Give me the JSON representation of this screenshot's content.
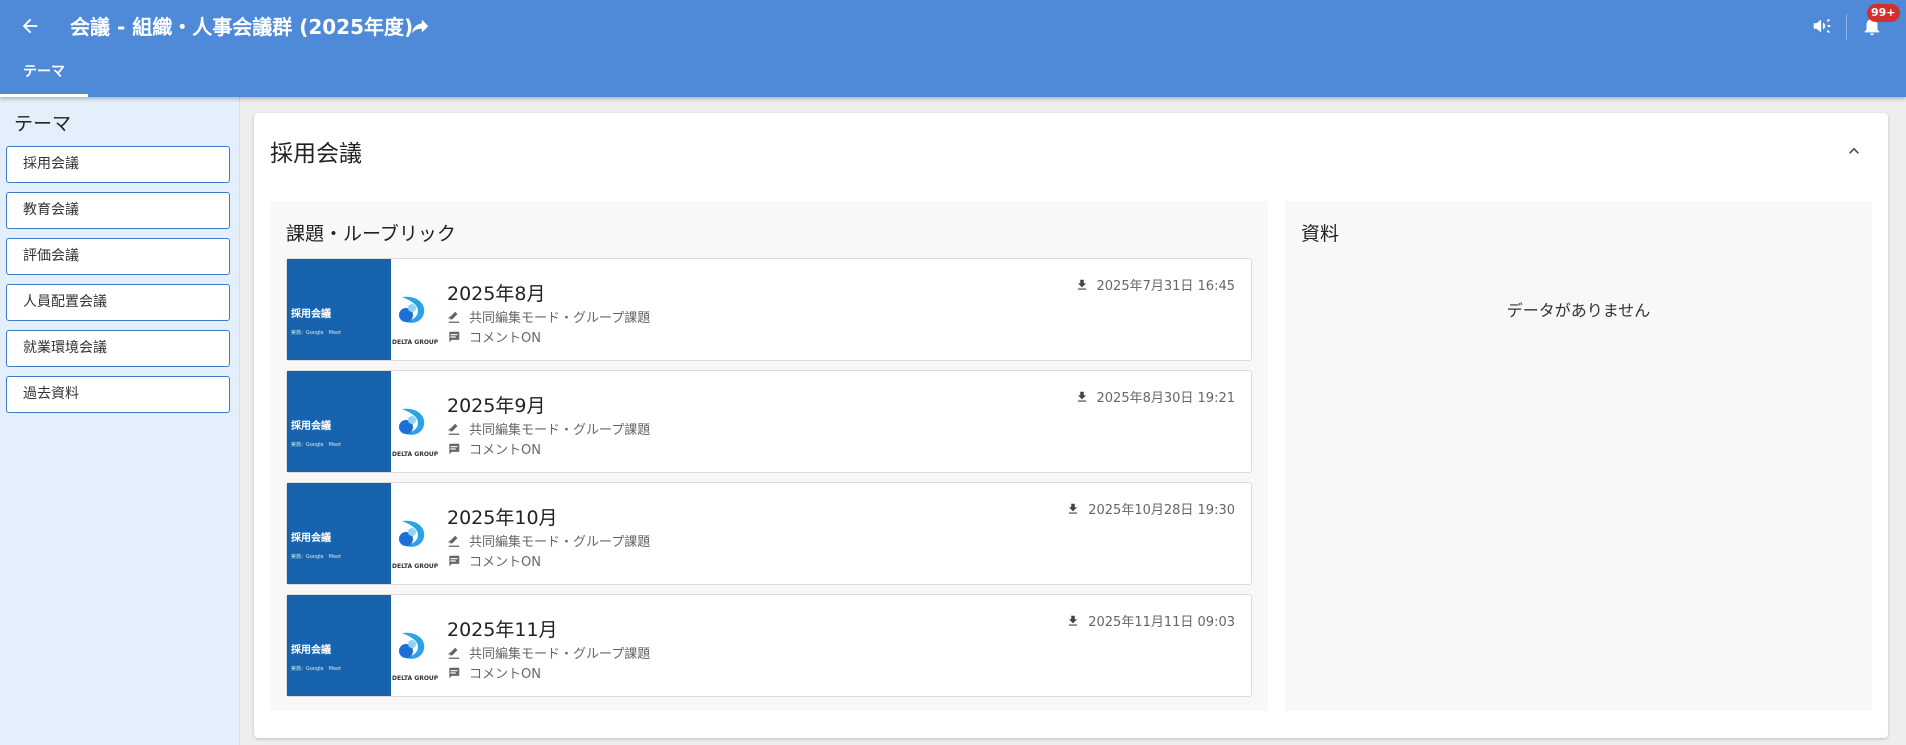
{
  "header": {
    "title": "会議 - 組織・人事会議群 (2025年度)",
    "tab_label": "テーマ",
    "notification_badge": "99+",
    "accent_color": "#4f8ad9"
  },
  "sidebar": {
    "title": "テーマ",
    "items": [
      {
        "label": "採用会議"
      },
      {
        "label": "教育会議"
      },
      {
        "label": "評価会議"
      },
      {
        "label": "人員配置会議"
      },
      {
        "label": "就業環境会議"
      },
      {
        "label": "過去資料"
      }
    ]
  },
  "section": {
    "title": "採用会議",
    "assignments": {
      "title": "課題・ルーブリック",
      "items": [
        {
          "month": "2025年8月",
          "date": "2025年7月31日 16:45",
          "mode": "共同編集モード・グループ課題",
          "comment": "コメントON",
          "thumb_title": "採用会議",
          "thumb_sub": "実施：Google　Meet",
          "logo_text": "DELTA GROUP"
        },
        {
          "month": "2025年9月",
          "date": "2025年8月30日 19:21",
          "mode": "共同編集モード・グループ課題",
          "comment": "コメントON",
          "thumb_title": "採用会議",
          "thumb_sub": "実施：Google　Meet",
          "logo_text": "DELTA GROUP"
        },
        {
          "month": "2025年10月",
          "date": "2025年10月28日 19:30",
          "mode": "共同編集モード・グループ課題",
          "comment": "コメントON",
          "thumb_title": "採用会議",
          "thumb_sub": "実施：Google　Meet",
          "logo_text": "DELTA GROUP"
        },
        {
          "month": "2025年11月",
          "date": "2025年11月11日 09:03",
          "mode": "共同編集モード・グループ課題",
          "comment": "コメントON",
          "thumb_title": "採用会議",
          "thumb_sub": "実施：Google　Meet",
          "logo_text": "DELTA GROUP"
        }
      ]
    },
    "materials": {
      "title": "資料",
      "empty_text": "データがありません"
    }
  },
  "icons": {
    "back": "arrow-left-icon",
    "share": "share-arrow-icon",
    "announce": "megaphone-icon",
    "notifications": "bell-icon",
    "collapse": "chevron-up-icon",
    "download": "download-icon",
    "mode": "group-edit-icon",
    "comment": "comment-icon"
  }
}
